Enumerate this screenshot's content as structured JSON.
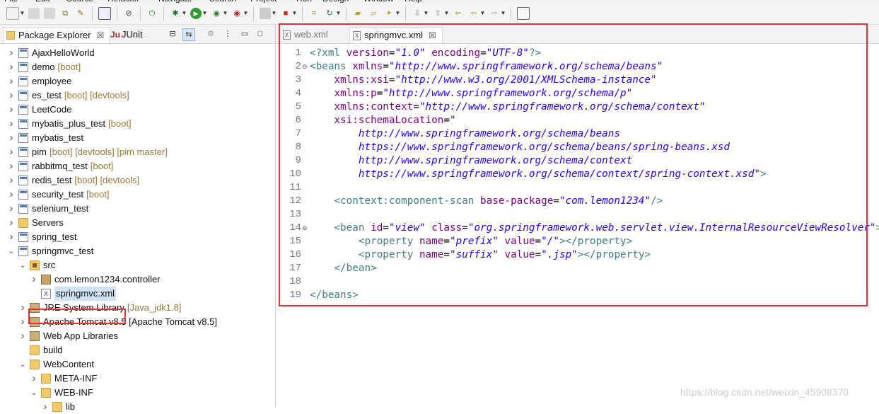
{
  "menu": [
    "File",
    "Edit",
    "Source",
    "Refactor",
    "Navigate",
    "Search",
    "Project",
    "Run",
    "Design",
    "Window",
    "Help"
  ],
  "left_tabs": {
    "package_explorer": "Package Explorer",
    "junit": "JUnit",
    "junit_icon": "Ju"
  },
  "tree": [
    {
      "label": "AjaxHelloWorld",
      "deco": "",
      "level": 0,
      "icon": "project",
      "expanded": false
    },
    {
      "label": "demo",
      "deco": "[boot]",
      "level": 0,
      "icon": "project",
      "expanded": false
    },
    {
      "label": "employee",
      "deco": "",
      "level": 0,
      "icon": "project",
      "expanded": false
    },
    {
      "label": "es_test",
      "deco": "[boot] [devtools]",
      "level": 0,
      "icon": "project",
      "expanded": false
    },
    {
      "label": "LeetCode",
      "deco": "",
      "level": 0,
      "icon": "project",
      "expanded": false
    },
    {
      "label": "mybatis_plus_test",
      "deco": "[boot]",
      "level": 0,
      "icon": "project",
      "expanded": false
    },
    {
      "label": "mybatis_test",
      "deco": "",
      "level": 0,
      "icon": "project",
      "expanded": false
    },
    {
      "label": "pim",
      "deco": "[boot] [devtools] [pim master]",
      "level": 0,
      "icon": "project",
      "expanded": false
    },
    {
      "label": "rabbitmq_test",
      "deco": "[boot]",
      "level": 0,
      "icon": "project",
      "expanded": false
    },
    {
      "label": "redis_test",
      "deco": "[boot] [devtools]",
      "level": 0,
      "icon": "project",
      "expanded": false
    },
    {
      "label": "security_test",
      "deco": "[boot]",
      "level": 0,
      "icon": "project",
      "expanded": false
    },
    {
      "label": "selenium_test",
      "deco": "",
      "level": 0,
      "icon": "project",
      "expanded": false
    },
    {
      "label": "Servers",
      "deco": "",
      "level": 0,
      "icon": "folder",
      "expanded": false
    },
    {
      "label": "spring_test",
      "deco": "",
      "level": 0,
      "icon": "project",
      "expanded": false
    },
    {
      "label": "springmvc_test",
      "deco": "",
      "level": 0,
      "icon": "project",
      "expanded": true
    },
    {
      "label": "src",
      "deco": "",
      "level": 1,
      "icon": "srcfolder",
      "expanded": true
    },
    {
      "label": "com.lemon1234.controller",
      "deco": "",
      "level": 2,
      "icon": "package",
      "expanded": false
    },
    {
      "label": "springmvc.xml",
      "deco": "",
      "level": 2,
      "icon": "xml",
      "leaf": true,
      "selected": true
    },
    {
      "label": "JRE System Library",
      "deco": "[Java_jdk1.8]",
      "level": 1,
      "icon": "lib",
      "expanded": false
    },
    {
      "label": "Apache Tomcat v8.5 [Apache Tomcat v8.5]",
      "deco": "",
      "level": 1,
      "icon": "lib",
      "expanded": false
    },
    {
      "label": "Web App Libraries",
      "deco": "",
      "level": 1,
      "icon": "lib",
      "expanded": false
    },
    {
      "label": "build",
      "deco": "",
      "level": 1,
      "icon": "folder",
      "leaf": true
    },
    {
      "label": "WebContent",
      "deco": "",
      "level": 1,
      "icon": "folder",
      "expanded": true
    },
    {
      "label": "META-INF",
      "deco": "",
      "level": 2,
      "icon": "folder",
      "expanded": false
    },
    {
      "label": "WEB-INF",
      "deco": "",
      "level": 2,
      "icon": "folder",
      "expanded": true
    },
    {
      "label": "lib",
      "deco": "",
      "level": 3,
      "icon": "folder",
      "expanded": false
    }
  ],
  "editor_tabs": [
    {
      "label": "web.xml",
      "active": false
    },
    {
      "label": "springmvc.xml",
      "active": true
    }
  ],
  "code_lines": [
    {
      "n": "1",
      "fold": "",
      "parts": [
        [
          "t",
          "<?xml "
        ],
        [
          "a",
          "version"
        ],
        [
          "",
          "="
        ],
        [
          "v",
          "\"1.0\""
        ],
        [
          "",
          " "
        ],
        [
          "a",
          "encoding"
        ],
        [
          "",
          "="
        ],
        [
          "v",
          "\"UTF-8\""
        ],
        [
          "t",
          "?>"
        ]
      ]
    },
    {
      "n": "2",
      "fold": "⊖",
      "parts": [
        [
          "t",
          "<beans "
        ],
        [
          "a",
          "xmlns"
        ],
        [
          "",
          "="
        ],
        [
          "v",
          "\"http://www.springframework.org/schema/beans\""
        ]
      ]
    },
    {
      "n": "3",
      "fold": "",
      "parts": [
        [
          "",
          "    "
        ],
        [
          "a",
          "xmlns:xsi"
        ],
        [
          "",
          "="
        ],
        [
          "v",
          "\"http://www.w3.org/2001/XMLSchema-instance\""
        ]
      ]
    },
    {
      "n": "4",
      "fold": "",
      "parts": [
        [
          "",
          "    "
        ],
        [
          "a",
          "xmlns:p"
        ],
        [
          "",
          "="
        ],
        [
          "v",
          "\"http://www.springframework.org/schema/p\""
        ]
      ]
    },
    {
      "n": "5",
      "fold": "",
      "parts": [
        [
          "",
          "    "
        ],
        [
          "a",
          "xmlns:context"
        ],
        [
          "",
          "="
        ],
        [
          "v",
          "\"http://www.springframework.org/schema/context\""
        ]
      ]
    },
    {
      "n": "6",
      "fold": "",
      "parts": [
        [
          "",
          "    "
        ],
        [
          "a",
          "xsi:schemaLocation"
        ],
        [
          "",
          "="
        ],
        [
          "v",
          "\""
        ]
      ]
    },
    {
      "n": "7",
      "fold": "",
      "parts": [
        [
          "",
          "        "
        ],
        [
          "v",
          "http://www.springframework.org/schema/beans"
        ]
      ]
    },
    {
      "n": "8",
      "fold": "",
      "parts": [
        [
          "",
          "        "
        ],
        [
          "v",
          "https://www.springframework.org/schema/beans/spring-beans.xsd"
        ]
      ]
    },
    {
      "n": "9",
      "fold": "",
      "parts": [
        [
          "",
          "        "
        ],
        [
          "v",
          "http://www.springframework.org/schema/context"
        ]
      ]
    },
    {
      "n": "10",
      "fold": "",
      "parts": [
        [
          "",
          "        "
        ],
        [
          "v",
          "https://www.springframework.org/schema/context/spring-context.xsd\""
        ],
        [
          "t",
          ">"
        ]
      ]
    },
    {
      "n": "11",
      "fold": "",
      "parts": []
    },
    {
      "n": "12",
      "fold": "",
      "parts": [
        [
          "",
          "    "
        ],
        [
          "t",
          "<context:component-scan "
        ],
        [
          "a",
          "base-package"
        ],
        [
          "",
          "="
        ],
        [
          "v",
          "\"com.lemon1234\""
        ],
        [
          "t",
          "/>"
        ]
      ]
    },
    {
      "n": "13",
      "fold": "",
      "parts": []
    },
    {
      "n": "14",
      "fold": "⊖",
      "parts": [
        [
          "",
          "    "
        ],
        [
          "t",
          "<bean "
        ],
        [
          "a",
          "id"
        ],
        [
          "",
          "="
        ],
        [
          "v",
          "\"view\""
        ],
        [
          "",
          " "
        ],
        [
          "a",
          "class"
        ],
        [
          "",
          "="
        ],
        [
          "v",
          "\"org.springframework.web.servlet.view.InternalResourceViewResolver\""
        ],
        [
          "t",
          ">"
        ]
      ]
    },
    {
      "n": "15",
      "fold": "",
      "parts": [
        [
          "",
          "        "
        ],
        [
          "t",
          "<property "
        ],
        [
          "a",
          "name"
        ],
        [
          "",
          "="
        ],
        [
          "v",
          "\"prefix\""
        ],
        [
          "",
          " "
        ],
        [
          "a",
          "value"
        ],
        [
          "",
          "="
        ],
        [
          "v",
          "\"/\""
        ],
        [
          "t",
          "></property>"
        ]
      ]
    },
    {
      "n": "16",
      "fold": "",
      "parts": [
        [
          "",
          "        "
        ],
        [
          "t",
          "<property "
        ],
        [
          "a",
          "name"
        ],
        [
          "",
          "="
        ],
        [
          "v",
          "\"suffix\""
        ],
        [
          "",
          " "
        ],
        [
          "a",
          "value"
        ],
        [
          "",
          "="
        ],
        [
          "v",
          "\".jsp\""
        ],
        [
          "t",
          "></property>"
        ]
      ]
    },
    {
      "n": "17",
      "fold": "",
      "parts": [
        [
          "",
          "    "
        ],
        [
          "t",
          "</bean>"
        ]
      ]
    },
    {
      "n": "18",
      "fold": "",
      "parts": []
    },
    {
      "n": "19",
      "fold": "",
      "parts": [
        [
          "t",
          "</beans>"
        ]
      ]
    }
  ],
  "watermark": "https://blog.csdn.net/weixin_45908370",
  "colors": {
    "highlight": "#e0333a",
    "tag": "#3f7f7f",
    "attr": "#7f007f",
    "value": "#2a00ff"
  }
}
